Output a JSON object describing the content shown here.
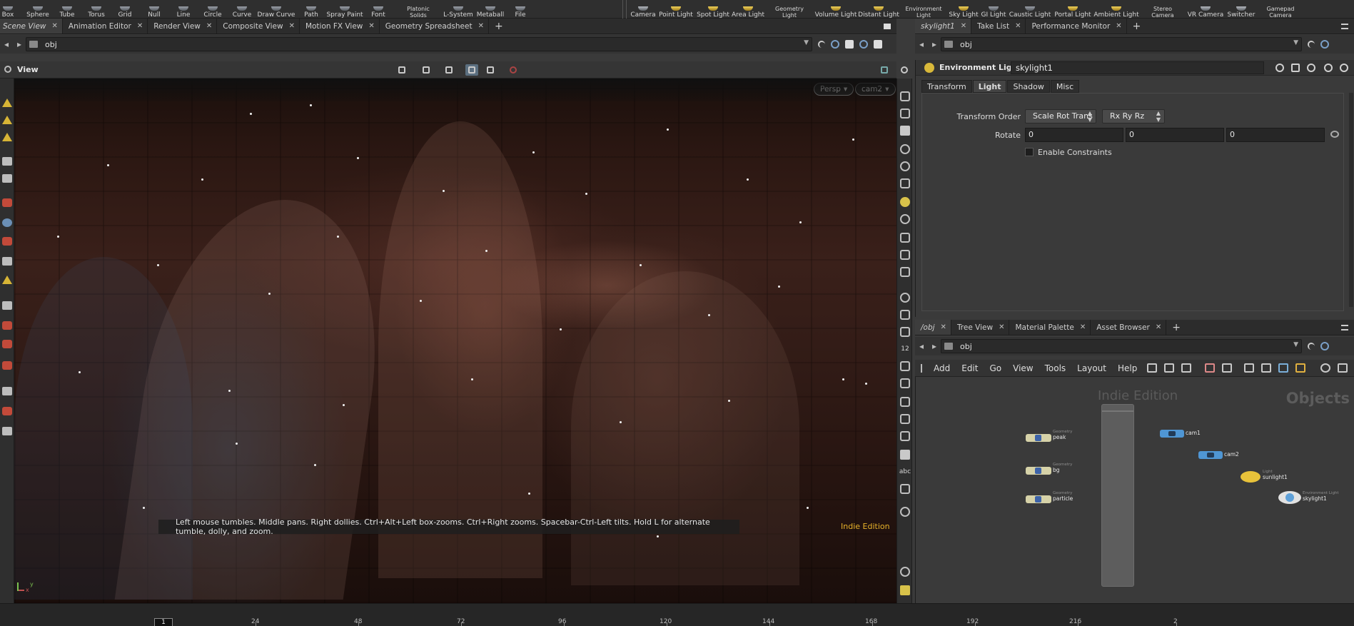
{
  "shelf": {
    "tools": [
      "Box",
      "Sphere",
      "Tube",
      "Torus",
      "Grid",
      "Null",
      "Line",
      "Circle",
      "Curve",
      "Draw Curve",
      "Path",
      "Spray Paint",
      "Font",
      "Platonic Solids",
      "L-System",
      "Metaball",
      "File"
    ],
    "light_tools": [
      "Camera",
      "Point Light",
      "Spot Light",
      "Area Light",
      "Geometry Light",
      "Volume Light",
      "Distant Light",
      "Environment Light",
      "Sky Light",
      "GI Light",
      "Caustic Light",
      "Portal Light",
      "Ambient Light",
      "Stereo Camera",
      "VR Camera",
      "Switcher",
      "Gamepad Camera"
    ]
  },
  "left_pane": {
    "tabs": [
      "Scene View",
      "Animation Editor",
      "Render View",
      "Composite View",
      "Motion FX View",
      "Geometry Spreadsheet"
    ],
    "path": "obj",
    "view_title": "View",
    "camera_pill": "Persp",
    "camera_name": "cam2",
    "hint": "Left mouse tumbles. Middle pans. Right dollies. Ctrl+Alt+Left box-zooms. Ctrl+Right zooms. Spacebar-Ctrl-Left tilts. Hold L for alternate tumble, dolly, and zoom.",
    "edition": "Indie Edition",
    "axis_x": "x",
    "axis_y": "y",
    "right_toolbar_labels": [
      "12",
      "abc"
    ]
  },
  "parameters": {
    "tabs": [
      "skylight1",
      "Take List",
      "Performance Monitor"
    ],
    "path": "obj",
    "node_type": "Environment Light",
    "node_name": "skylight1",
    "param_tabs": [
      "Transform",
      "Light",
      "Shadow",
      "Misc"
    ],
    "transform_order_label": "Transform Order",
    "transform_order_value": "Scale Rot Trans",
    "rotate_order_value": "Rx Ry Rz",
    "rotate_label": "Rotate",
    "rotate_values": [
      "0",
      "0",
      "0"
    ],
    "enable_constraints_label": "Enable Constraints"
  },
  "network": {
    "tabs": [
      "/obj",
      "Tree View",
      "Material Palette",
      "Asset Browser"
    ],
    "path": "obj",
    "menus": [
      "Add",
      "Edit",
      "Go",
      "View",
      "Tools",
      "Layout",
      "Help"
    ],
    "edition": "Indie Edition",
    "context": "Objects",
    "nodes": [
      {
        "name": "peak",
        "type": "Geometry"
      },
      {
        "name": "bg",
        "type": "Geometry"
      },
      {
        "name": "particle",
        "type": "Geometry"
      },
      {
        "name": "cam1",
        "type": ""
      },
      {
        "name": "cam2",
        "type": ""
      },
      {
        "name": "sunlight1",
        "type": "Light"
      },
      {
        "name": "skylight1",
        "type": "Environment Light"
      }
    ]
  },
  "timeline": {
    "current_frame": "1",
    "ticks": [
      "24",
      "48",
      "72",
      "96",
      "120",
      "144",
      "168",
      "192",
      "216",
      "2"
    ]
  },
  "colors": {
    "accent_yellow": "#e8b22a",
    "active_tool": "#5b6f80",
    "panel": "#3a3a3a"
  }
}
